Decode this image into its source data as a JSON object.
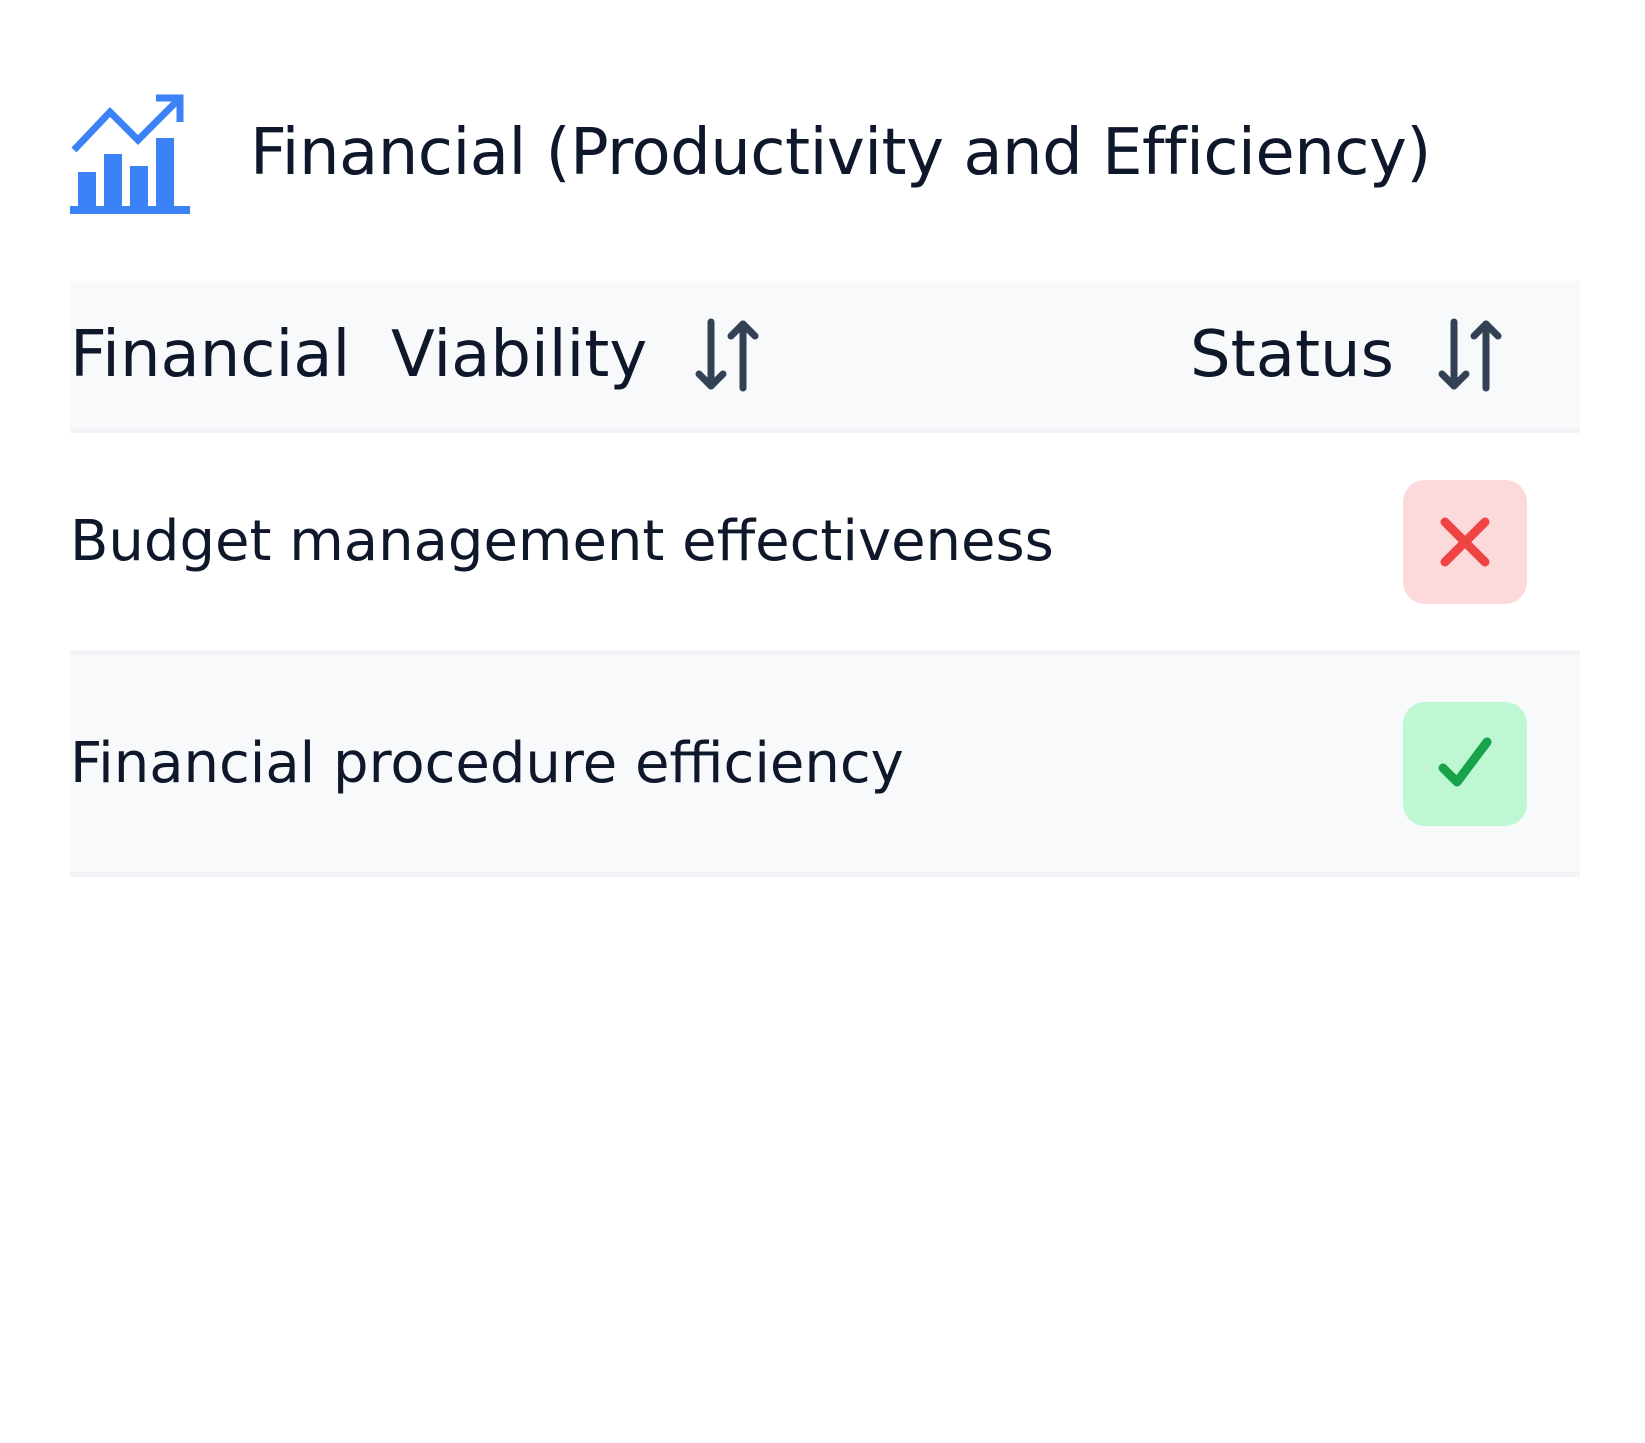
{
  "header": {
    "title": "Financial (Productivity and Efficiency)",
    "icon": "chart-trend-up-icon",
    "icon_color": "#3b82f6"
  },
  "table": {
    "columns": [
      {
        "label": "Financial  Viability",
        "sort_icon": "sort-arrows-icon"
      },
      {
        "label": "Status",
        "sort_icon": "sort-arrows-icon"
      }
    ],
    "rows": [
      {
        "name": "Budget management effectiveness",
        "status": "fail",
        "status_icon": "cross-icon"
      },
      {
        "name": "Financial procedure efficiency",
        "status": "pass",
        "status_icon": "check-icon"
      }
    ]
  },
  "colors": {
    "text": "#0f172a",
    "sort_icon": "#334155",
    "fail_bg": "#fcdadb",
    "fail_icon": "#ef4444",
    "pass_bg": "#bff7d2",
    "pass_icon": "#16a34a",
    "header_bg": "#f8f9fb"
  }
}
